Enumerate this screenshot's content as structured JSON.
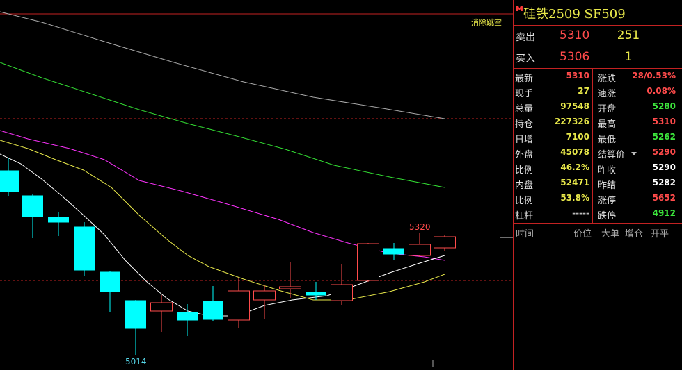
{
  "chart": {
    "clear_gap_label": "消除跳空",
    "high_label": "5320",
    "low_label": "5014",
    "colors": {
      "up": "#ff4b4b",
      "down": "#00ffff",
      "ma1": "#ffffff",
      "ma2": "#e8e84a",
      "ma3": "#ff33ff",
      "ma4": "#33dd33",
      "ma5": "#aaaaaa",
      "grid": "#c32222"
    }
  },
  "header": {
    "badge": "M",
    "title": "硅铁2509  SF509"
  },
  "order_book": {
    "ask": {
      "label": "卖出",
      "price": "5310",
      "volume": "251"
    },
    "bid": {
      "label": "买入",
      "price": "5306",
      "volume": "1"
    }
  },
  "stats": [
    {
      "l": "最新",
      "lv": "5310",
      "lc": "red",
      "r": "涨跌",
      "rv": "28/0.53%",
      "rc": "red"
    },
    {
      "l": "现手",
      "lv": "27",
      "lc": "yellow",
      "r": "速涨",
      "rv": "0.08%",
      "rc": "red"
    },
    {
      "l": "总量",
      "lv": "97548",
      "lc": "yellow",
      "r": "开盘",
      "rv": "5280",
      "rc": "green"
    },
    {
      "l": "持仓",
      "lv": "227326",
      "lc": "yellow",
      "r": "最高",
      "rv": "5310",
      "rc": "red"
    },
    {
      "l": "日增",
      "lv": "7100",
      "lc": "yellow",
      "r": "最低",
      "rv": "5262",
      "rc": "green"
    },
    {
      "l": "外盘",
      "lv": "45078",
      "lc": "yellow",
      "r": "结算价",
      "rv": "5290",
      "rc": "red"
    },
    {
      "l": "比例",
      "lv": "46.2%",
      "lc": "yellow",
      "r": "昨收",
      "rv": "5290",
      "rc": "white"
    },
    {
      "l": "内盘",
      "lv": "52471",
      "lc": "yellow",
      "r": "昨结",
      "rv": "5282",
      "rc": "white"
    },
    {
      "l": "比例",
      "lv": "53.8%",
      "lc": "yellow",
      "r": "涨停",
      "rv": "5652",
      "rc": "red"
    },
    {
      "l": "杠杆",
      "lv": "-----",
      "lc": "grey",
      "r": "跌停",
      "rv": "4912",
      "rc": "green"
    }
  ],
  "trades_header": {
    "time": "时间",
    "price": "价位",
    "big_order": "大单",
    "oi_change": "增仓",
    "open_close": "开平"
  }
}
